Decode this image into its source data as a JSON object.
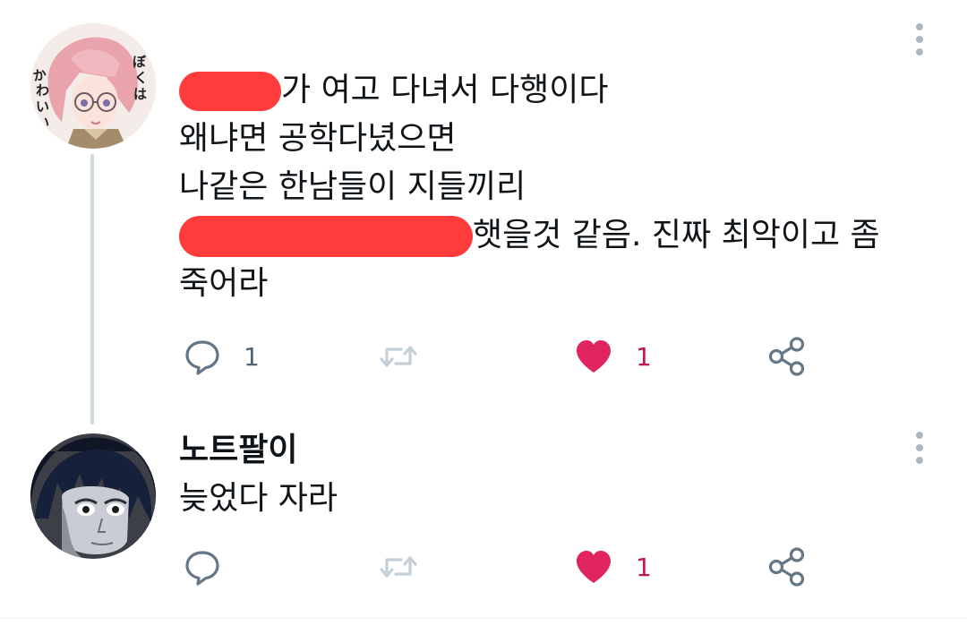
{
  "thread": [
    {
      "author_name": "",
      "text_lines": [
        "가 여고 다녀서 다행이다",
        "왜냐면 공학다녔으면",
        "나같은 한남들이 지들끼리",
        "햇을것 같음. 진짜 최악이고 좀",
        "죽어라"
      ],
      "redacted_segments": 2,
      "actions": {
        "reply_count": "1",
        "retweet_count": "",
        "like_count": "1",
        "liked": true
      },
      "avatar_text": "ぼくは かわいい?"
    },
    {
      "author_name": "노트팔이",
      "text_lines": [
        "늦었다 자라"
      ],
      "actions": {
        "reply_count": "",
        "retweet_count": "",
        "like_count": "1",
        "liked": true
      }
    }
  ],
  "icons": {
    "reply": "reply-icon",
    "retweet": "retweet-icon",
    "like": "heart-icon",
    "share": "share-icon",
    "more": "more-vertical-icon"
  },
  "colors": {
    "redaction": "#ff3b3b",
    "like_active": "#e0245e",
    "icon_gray": "#657786",
    "thread_line": "#cfd9de",
    "retweet_disabled": "#c4cfd6"
  }
}
